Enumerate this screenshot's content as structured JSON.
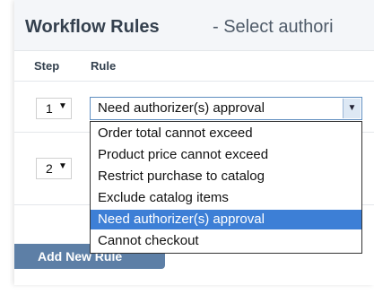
{
  "header": {
    "title_bold": "Workflow Rules",
    "title_rest": " - Select authori"
  },
  "columns": {
    "step": "Step",
    "rule": "Rule"
  },
  "rows": [
    {
      "step": "1",
      "rule": "Need authorizer(s) approval"
    },
    {
      "step": "2"
    }
  ],
  "icons": {
    "dropdown_arrow": "▼"
  },
  "dropdown": {
    "options": [
      "Order total cannot exceed",
      "Product price cannot exceed",
      "Restrict purchase to catalog",
      "Exclude catalog items",
      "Need authorizer(s) approval",
      "Cannot checkout"
    ],
    "selected_index": 4
  },
  "add_button": {
    "label": "Add New Rule"
  },
  "colors": {
    "accent": "#3d7fd6",
    "button": "#5d7fa6"
  }
}
